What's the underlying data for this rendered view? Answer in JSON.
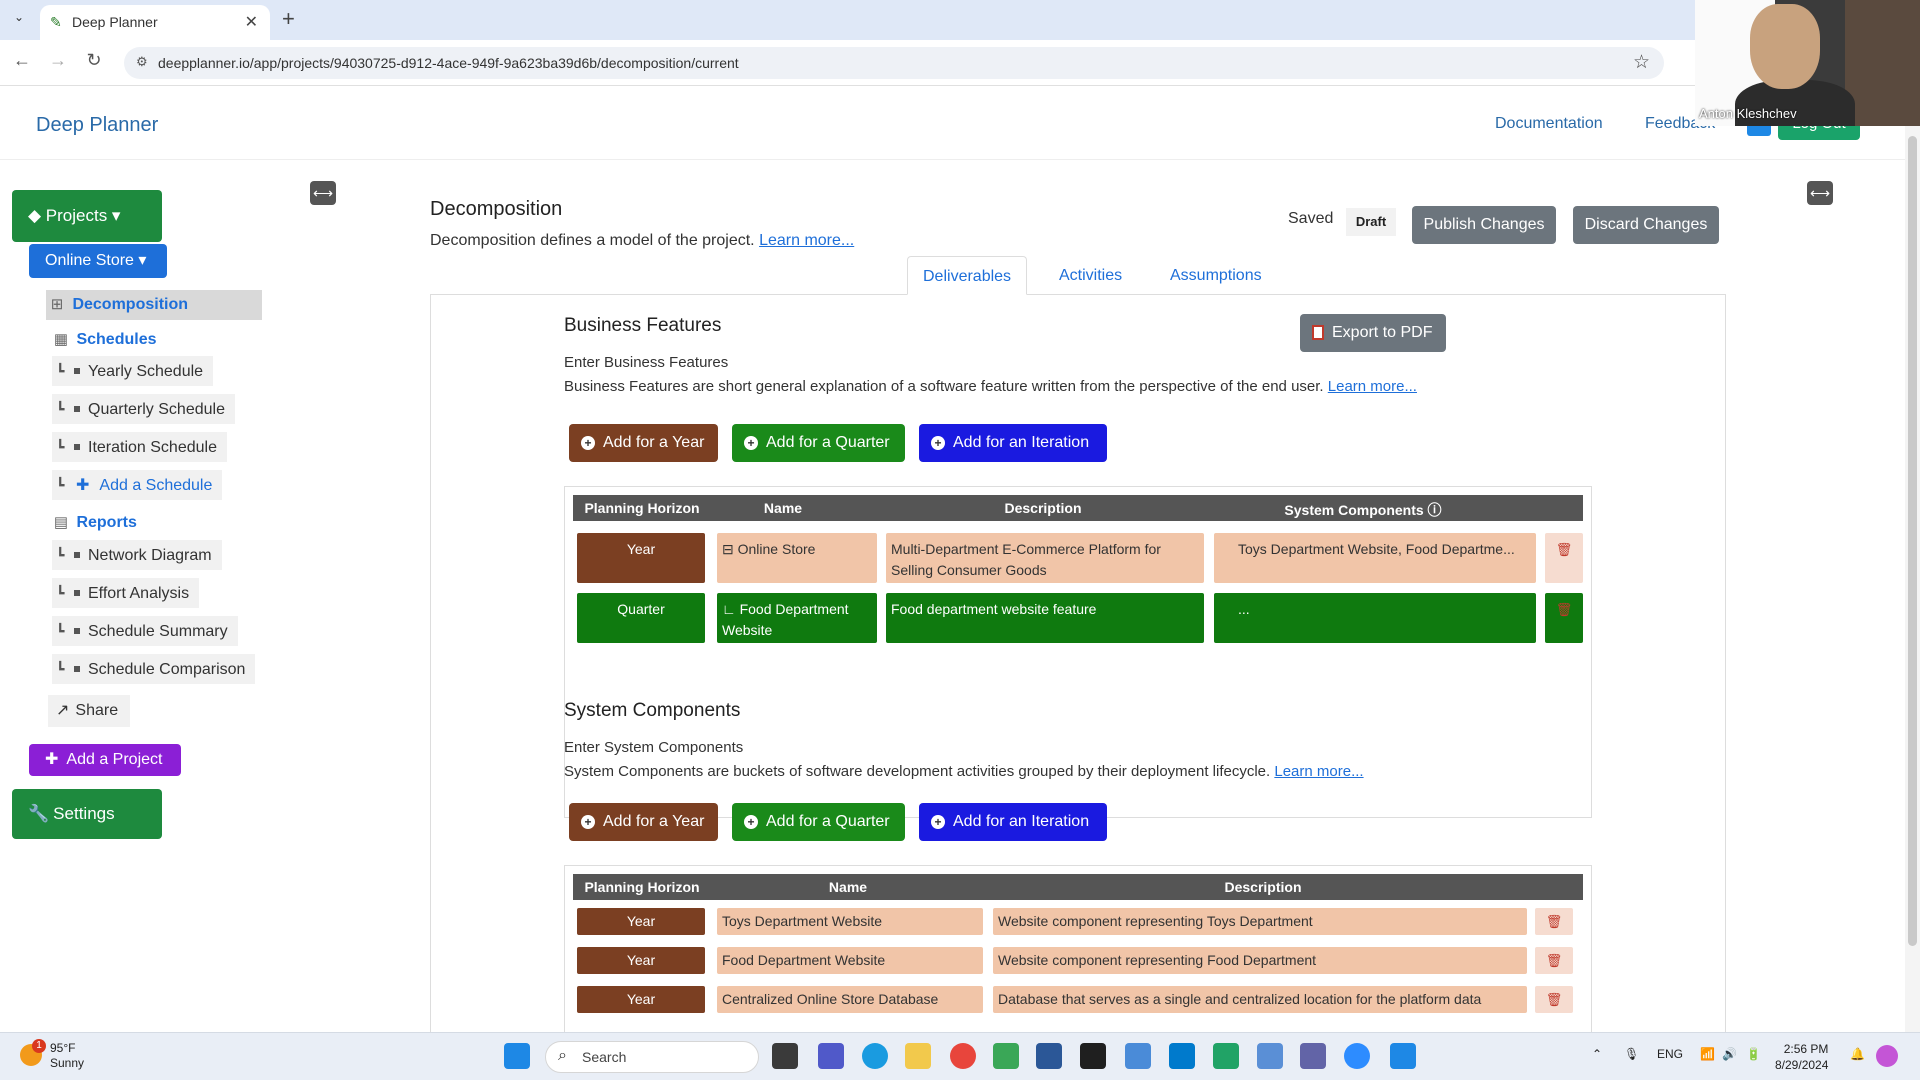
{
  "browser": {
    "tab_title": "Deep Planner",
    "url": "deepplanner.io/app/projects/94030725-d912-4ace-949f-9a623ba39d6b/decomposition/current"
  },
  "video": {
    "participant_name": "Anton Kleshchev"
  },
  "header": {
    "brand": "Deep Planner",
    "documentation": "Documentation",
    "feedback": "Feedback",
    "logout": "Log Out"
  },
  "sidebar": {
    "projects": "Projects ▾",
    "project_name": "Online Store ▾",
    "decomposition": "Decomposition",
    "schedules": "Schedules",
    "schedule_items": [
      "Yearly Schedule",
      "Quarterly Schedule",
      "Iteration Schedule"
    ],
    "add_schedule": "Add a Schedule",
    "reports": "Reports",
    "report_items": [
      "Network Diagram",
      "Effort Analysis",
      "Schedule Summary",
      "Schedule Comparison"
    ],
    "share": "Share",
    "add_project": "Add a Project",
    "settings": "Settings"
  },
  "page": {
    "title": "Decomposition",
    "subtitle": "Decomposition defines a model of the project.",
    "learn_more": "Learn more...",
    "saved": "Saved",
    "draft": "Draft",
    "publish": "Publish Changes",
    "discard": "Discard Changes",
    "tabs": [
      "Deliverables",
      "Activities",
      "Assumptions"
    ]
  },
  "business_features": {
    "title": "Business Features",
    "enter_text": "Enter Business Features",
    "description": "Business Features are short general explanation of a software feature written from the perspective of the end user.",
    "learn_more": "Learn more...",
    "export": "Export to PDF",
    "add_year": "Add for a Year",
    "add_quarter": "Add for a Quarter",
    "add_iteration": "Add for an Iteration",
    "columns": [
      "Planning Horizon",
      "Name",
      "Description",
      "System Components ⓘ"
    ],
    "rows": [
      {
        "horizon": "Year",
        "name": "⊟ Online Store",
        "description": "Multi-Department E-Commerce Platform for Selling Consumer Goods",
        "components": "Toys Department Website, Food Departme..."
      },
      {
        "horizon": "Quarter",
        "name": "∟ Food Department Website",
        "description": "Food department website feature",
        "components": "..."
      }
    ]
  },
  "system_components": {
    "title": "System Components",
    "enter_text": "Enter System Components",
    "description": "System Components are buckets of software development activities grouped by their deployment lifecycle.",
    "learn_more": "Learn more...",
    "add_year": "Add for a Year",
    "add_quarter": "Add for a Quarter",
    "add_iteration": "Add for an Iteration",
    "columns": [
      "Planning Horizon",
      "Name",
      "Description"
    ],
    "rows": [
      {
        "horizon": "Year",
        "name": "Toys Department Website",
        "description": "Website component representing Toys Department"
      },
      {
        "horizon": "Year",
        "name": "Food Department Website",
        "description": "Website component representing Food Department"
      },
      {
        "horizon": "Year",
        "name": "Centralized Online Store Database",
        "description": "Database that serves as a single and centralized location for the platform data"
      }
    ]
  },
  "taskbar": {
    "weather_temp": "95°F",
    "weather_desc": "Sunny",
    "weather_badge": "1",
    "search": "Search",
    "lang": "ENG",
    "time": "2:56 PM",
    "date": "8/29/2024"
  },
  "colors": {
    "brown": "#7b3f22",
    "green": "#1a8a1a",
    "blue": "#1a1ae0",
    "peach": "#f1c5a8",
    "purple": "#8b1fd6"
  }
}
